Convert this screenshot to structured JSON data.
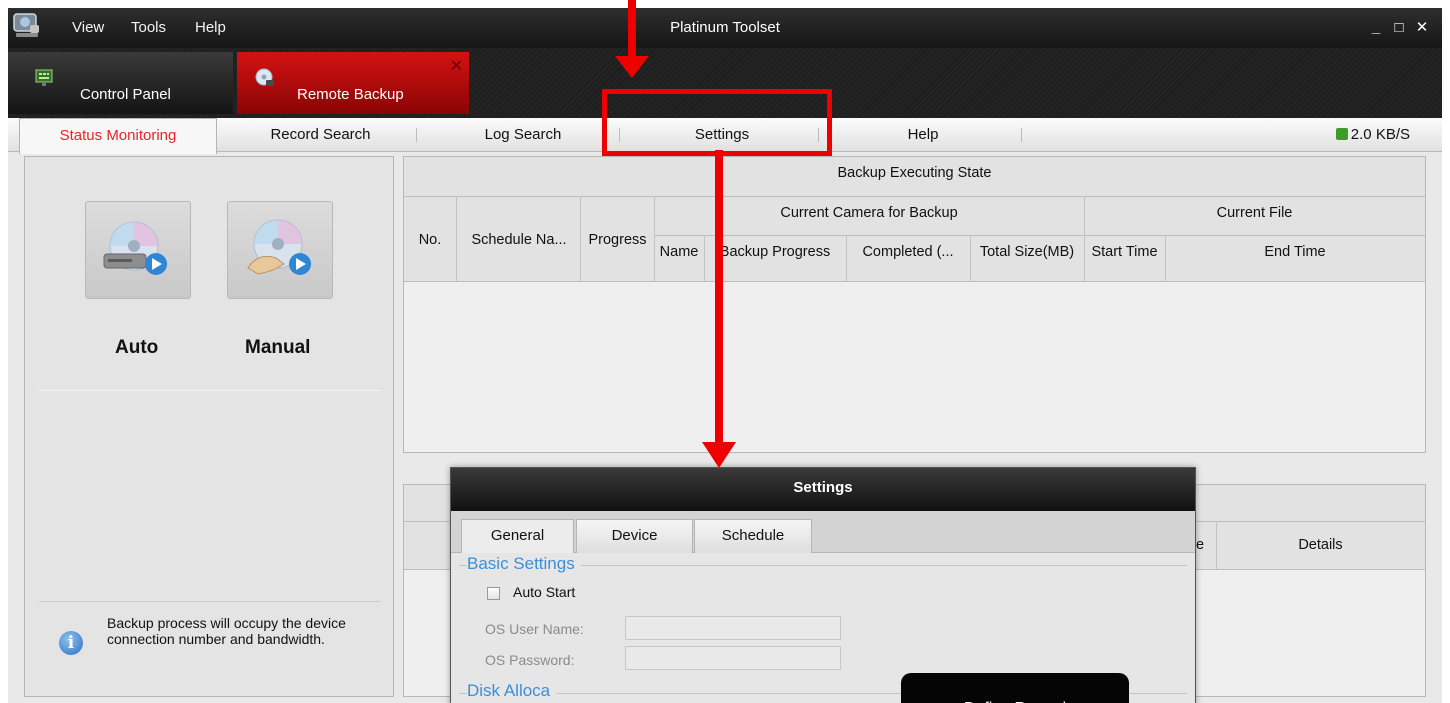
{
  "window": {
    "title": "Platinum Toolset",
    "menu": [
      "View",
      "Tools",
      "Help"
    ],
    "controls": {
      "minimize": "_",
      "maximize": "□",
      "close": "✕"
    }
  },
  "module_tabs": [
    {
      "label": "Control Panel",
      "icon": "monitor-icon"
    },
    {
      "label": "Remote Backup",
      "icon": "disc-icon",
      "close": "✕"
    }
  ],
  "sub_tabs": [
    "Status Monitoring",
    "Record Search",
    "Log Search",
    "Settings",
    "Help"
  ],
  "active_sub_tab": "Status Monitoring",
  "speed": "2.0 KB/S",
  "left_panel": {
    "auto_label": "Auto",
    "manual_label": "Manual",
    "info_text": "Backup process will occupy the device connection number and bandwidth."
  },
  "backup_table": {
    "title": "Backup Executing State",
    "col_no": "No.",
    "col_schedule": "Schedule Na...",
    "col_progress": "Progress",
    "group_camera": "Current  Camera for Backup",
    "group_file": "Current File",
    "col_name": "Name",
    "col_backup_progress": "Backup Progress",
    "col_completed": "Completed (...",
    "col_total_size": "Total Size(MB)",
    "col_start_time": "Start Time",
    "col_end_time": "End Time"
  },
  "log_table": {
    "col_partial": "e",
    "col_details": "Details"
  },
  "settings_dialog": {
    "title": "Settings",
    "tabs": [
      "General",
      "Device",
      "Schedule"
    ],
    "active_tab": "General",
    "basic_settings_title": "Basic Settings",
    "auto_start_label": "Auto Start",
    "auto_start_checked": false,
    "os_user_label": "OS User Name:",
    "os_user_value": "",
    "os_password_label": "OS Password:",
    "os_password_value": "",
    "disk_alloc_title": "Disk Alloca",
    "tooltip": "Define Record"
  },
  "colors": {
    "accent_red": "#e32727",
    "annotation_red": "#ee0000",
    "group_title_blue": "#3b8fd9",
    "speed_icon_green": "#3a9d2a"
  }
}
